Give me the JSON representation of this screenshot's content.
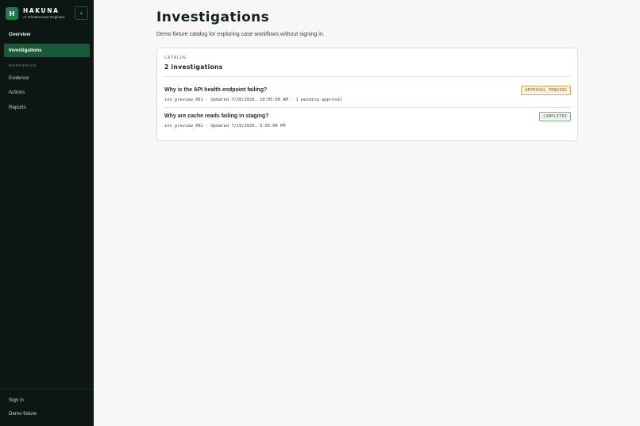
{
  "brand": {
    "mark": "H",
    "name": "HAKUNA",
    "subtitle": "AI Infrastructure Engineer",
    "collapse_icon": "chevron-left-icon"
  },
  "sidebar": {
    "items": [
      {
        "label": "Overview",
        "active": false
      },
      {
        "label": "Investigations",
        "active": true
      }
    ],
    "section_label": "WORKSPACE",
    "workspace_items": [
      {
        "label": "Evidence"
      },
      {
        "label": "Actions"
      },
      {
        "label": "Reports"
      }
    ],
    "footer_items": [
      {
        "label": "Sign in"
      },
      {
        "label": "Demo fixture"
      }
    ]
  },
  "header": {
    "title": "Investigations",
    "description": "Demo fixture catalog for exploring case workflows without signing in."
  },
  "catalog": {
    "eyebrow": "CATALOG",
    "heading": "2 investigations",
    "items": [
      {
        "title": "Why is the API health endpoint failing?",
        "meta": "inv_preview_001 · Updated 7/20/2026, 10:05:00 AM · 1 pending approval",
        "status": "APPROVAL_PENDING"
      },
      {
        "title": "Why are cache reads failing in staging?",
        "meta": "inv_preview_002 · Updated 7/19/2026, 5:05:00 PM",
        "status": "COMPLETED"
      }
    ]
  },
  "colors": {
    "sidebar_bg": "#0c1612",
    "accent": "#165a36",
    "pending": "#e0a64a",
    "completed": "#7fa98b"
  }
}
